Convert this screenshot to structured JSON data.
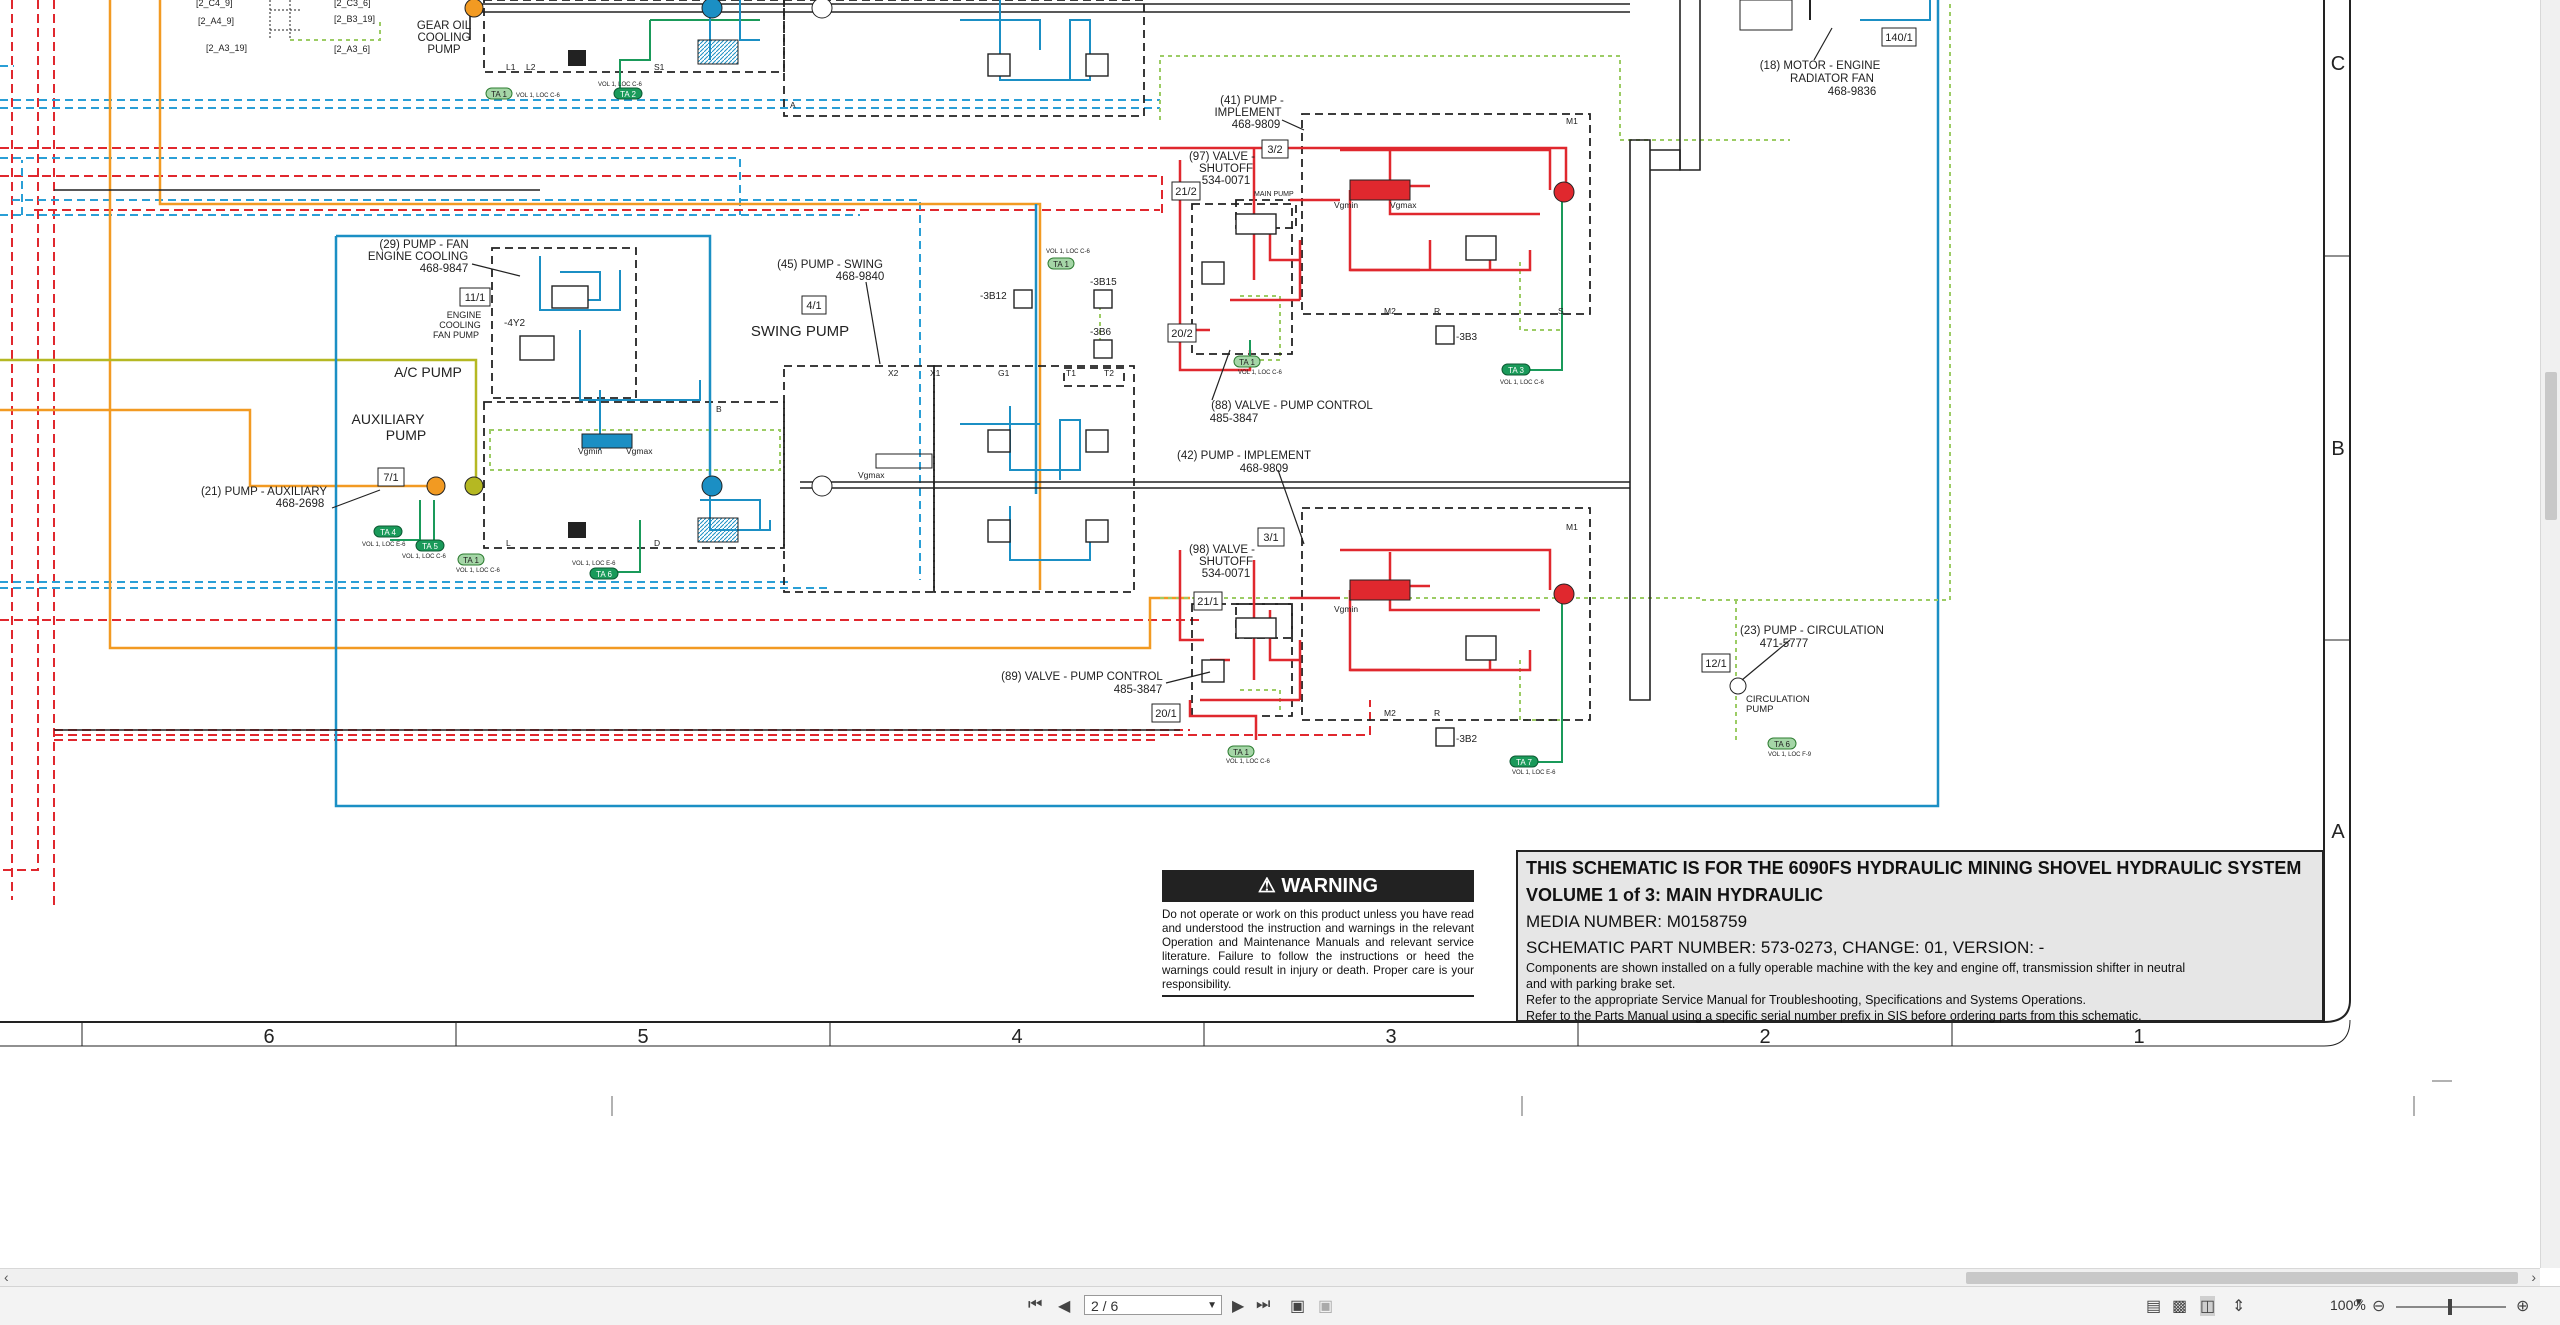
{
  "schematic": {
    "zone_rows": [
      "C",
      "B",
      "A"
    ],
    "zone_cols": [
      "6",
      "5",
      "4",
      "3",
      "2",
      "1"
    ],
    "top_fragments": [
      "[2_A4_9]",
      "[2_B3_19]",
      "[2_A3_19]",
      "[2_A3_6]",
      "[2_C3_6]",
      "[2_C4_9]"
    ],
    "components": {
      "gear_oil_pump": "GEAR OIL\nCOOLING\nPUMP",
      "motor_engine_radiator_fan": "(18) MOTOR - ENGINE\nRADIATOR FAN\n468-9836",
      "pump_implement_41": "(41) PUMP -\nIMPLEMENT\n468-9809",
      "valve_shutoff_97": "(97) VALVE -\nSHUTOFF\n534-0071",
      "pump_fan_29": "(29) PUMP - FAN\nENGINE COOLING\n468-9847",
      "engine_cooling_fan_pump": "ENGINE\nCOOLING\nFAN PUMP",
      "pump_swing_45": "(45) PUMP - SWING\n468-9840",
      "swing_pump": "SWING PUMP",
      "ac_pump": "A/C  PUMP",
      "auxiliary_pump": "AUXILIARY\nPUMP",
      "pump_auxiliary_21": "(21) PUMP - AUXILIARY\n468-2698",
      "valve_pump_control_88": "(88) VALVE - PUMP CONTROL\n485-3847",
      "pump_implement_42": "(42) PUMP - IMPLEMENT\n468-9809",
      "valve_shutoff_98": "(98) VALVE -\nSHUTOFF\n534-0071",
      "valve_pump_control_89": "(89) VALVE - PUMP CONTROL\n485-3847",
      "pump_circulation_23": "(23) PUMP - CIRCULATION\n471-5777",
      "circulation_pump": "CIRCULATION\nPUMP",
      "main_pump": "MAIN PUMP"
    },
    "ref_boxes": [
      "140/1",
      "3/2",
      "21/2",
      "11/1",
      "4/1",
      "20/2",
      "7/1",
      "3/1",
      "21/1",
      "20/1",
      "12/1"
    ],
    "sensor_tags": [
      "-3B12",
      "-3B15",
      "-3B6",
      "-3B3",
      "-3B2",
      "-4Y2"
    ],
    "port_labels": [
      "L1",
      "L2",
      "S1",
      "B",
      "X2",
      "X1",
      "G1",
      "T1",
      "T2",
      "M1",
      "M2",
      "R",
      "S",
      "A",
      "L",
      "D",
      "Vgmin",
      "Vgmax"
    ],
    "ta_badges": [
      "TA 1",
      "TA 2",
      "TA 3",
      "TA 4",
      "TA 5",
      "TA 6",
      "TA 7"
    ],
    "vol_refs": [
      "VOL 1, LOC C-6",
      "VOL 1, LOC E-6",
      "VOL 1, LOC F-9"
    ]
  },
  "warning": {
    "heading": "WARNING",
    "text": "Do not operate or work on this product unless you have read and understood the instruction and warnings in the relevant Operation and Maintenance Manuals and relevant service literature. Failure to follow the instructions or heed the warnings could result in injury or death. Proper care is your responsibility."
  },
  "title_block": {
    "line1": "THIS SCHEMATIC IS FOR THE 6090FS HYDRAULIC MINING SHOVEL HYDRAULIC SYSTEM",
    "line2": "VOLUME 1 of 3: MAIN HYDRAULIC",
    "media": "MEDIA NUMBER: M0158759",
    "part": "SCHEMATIC PART NUMBER: 573-0273, CHANGE: 01, VERSION: -",
    "note1": "Components are shown installed on a fully operable machine with the key and engine off, transmission shifter in neutral and with parking brake set.",
    "note2": "Refer to the appropriate Service Manual for Troubleshooting, Specifications and Systems Operations.",
    "note3": "Refer to the Parts Manual using a specific serial number prefix in SIS before ordering parts from this schematic."
  },
  "viewer": {
    "page_value": "2 / 6",
    "zoom": "100%",
    "icons": [
      "first-page-icon",
      "prev-page-icon",
      "next-page-icon",
      "last-page-icon",
      "fit-page-icon",
      "fit-width-icon",
      "single-page-icon",
      "continuous-icon",
      "two-page-icon",
      "scroll-icon",
      "zoom-out-icon",
      "zoom-in-icon"
    ]
  },
  "colors": {
    "red_line": "#e0282e",
    "blue_line": "#1b8fc4",
    "dashed_blue": "#2a9fd6",
    "orange_line": "#f29a22",
    "olive_line": "#b5b822",
    "green_line": "#1a9a5a",
    "pilot_dotted": "#9ccc65",
    "black_line": "#222222",
    "title_bg": "#e6e6e6"
  }
}
